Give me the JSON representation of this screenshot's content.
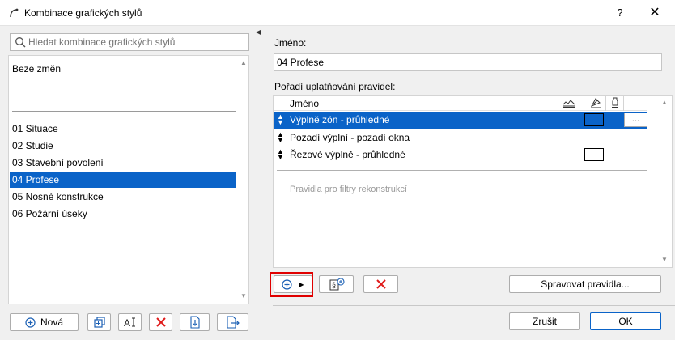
{
  "window": {
    "title": "Kombinace grafických stylů",
    "help_label": "?",
    "close_label": "✕"
  },
  "left": {
    "search_placeholder": "Hledat kombinace grafických stylů",
    "no_change_item": "Beze změn",
    "items": [
      {
        "label": "01 Situace"
      },
      {
        "label": "02 Studie"
      },
      {
        "label": "03 Stavební povolení"
      },
      {
        "label": "04 Profese",
        "selected": true
      },
      {
        "label": "05 Nosné konstrukce"
      },
      {
        "label": "06 Požární úseky"
      }
    ],
    "new_button_label": "Nová"
  },
  "right": {
    "name_label": "Jméno:",
    "name_value": "04 Profese",
    "order_label": "Pořadí uplatňování pravidel:",
    "column_name": "Jméno",
    "rules": [
      {
        "name": "Výplně zón - průhledné",
        "selected": true,
        "has_swatch": true,
        "more_label": "..."
      },
      {
        "name": "Pozadí výplní - pozadí okna",
        "selected": false,
        "has_swatch": false
      },
      {
        "name": "Řezové výplně - průhledné",
        "selected": false,
        "has_swatch": true
      }
    ],
    "filter_placeholder": "Pravidla pro filtry rekonstrukcí",
    "manage_rules_label": "Spravovat pravidla...",
    "cancel_label": "Zrušit",
    "ok_label": "OK"
  },
  "colors": {
    "selection": "#0a63c8",
    "highlight_border": "#e00000",
    "delete_red": "#e01b1b"
  }
}
